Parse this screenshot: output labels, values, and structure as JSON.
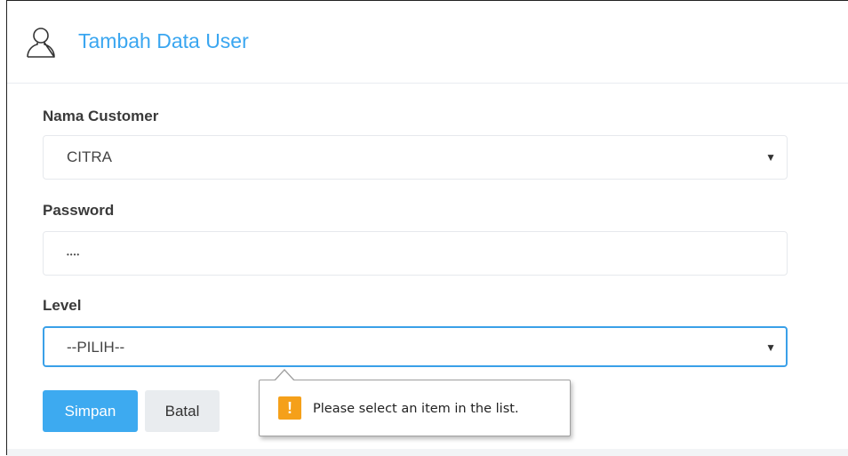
{
  "header": {
    "icon": "user-outline-icon",
    "title": "Tambah Data User"
  },
  "form": {
    "customer": {
      "label": "Nama Customer",
      "value": "CITRA",
      "caret": "▼"
    },
    "password": {
      "label": "Password",
      "value": "••••"
    },
    "level": {
      "label": "Level",
      "value": "--PILIH--",
      "caret": "▼"
    }
  },
  "buttons": {
    "save_label": "Simpan",
    "cancel_label": "Batal"
  },
  "validation": {
    "icon": "!",
    "message": "Please select an item in the list."
  },
  "colors": {
    "accent": "#3aa6f0",
    "focus_border": "#3aa0e8",
    "warning": "#f5a01a"
  }
}
